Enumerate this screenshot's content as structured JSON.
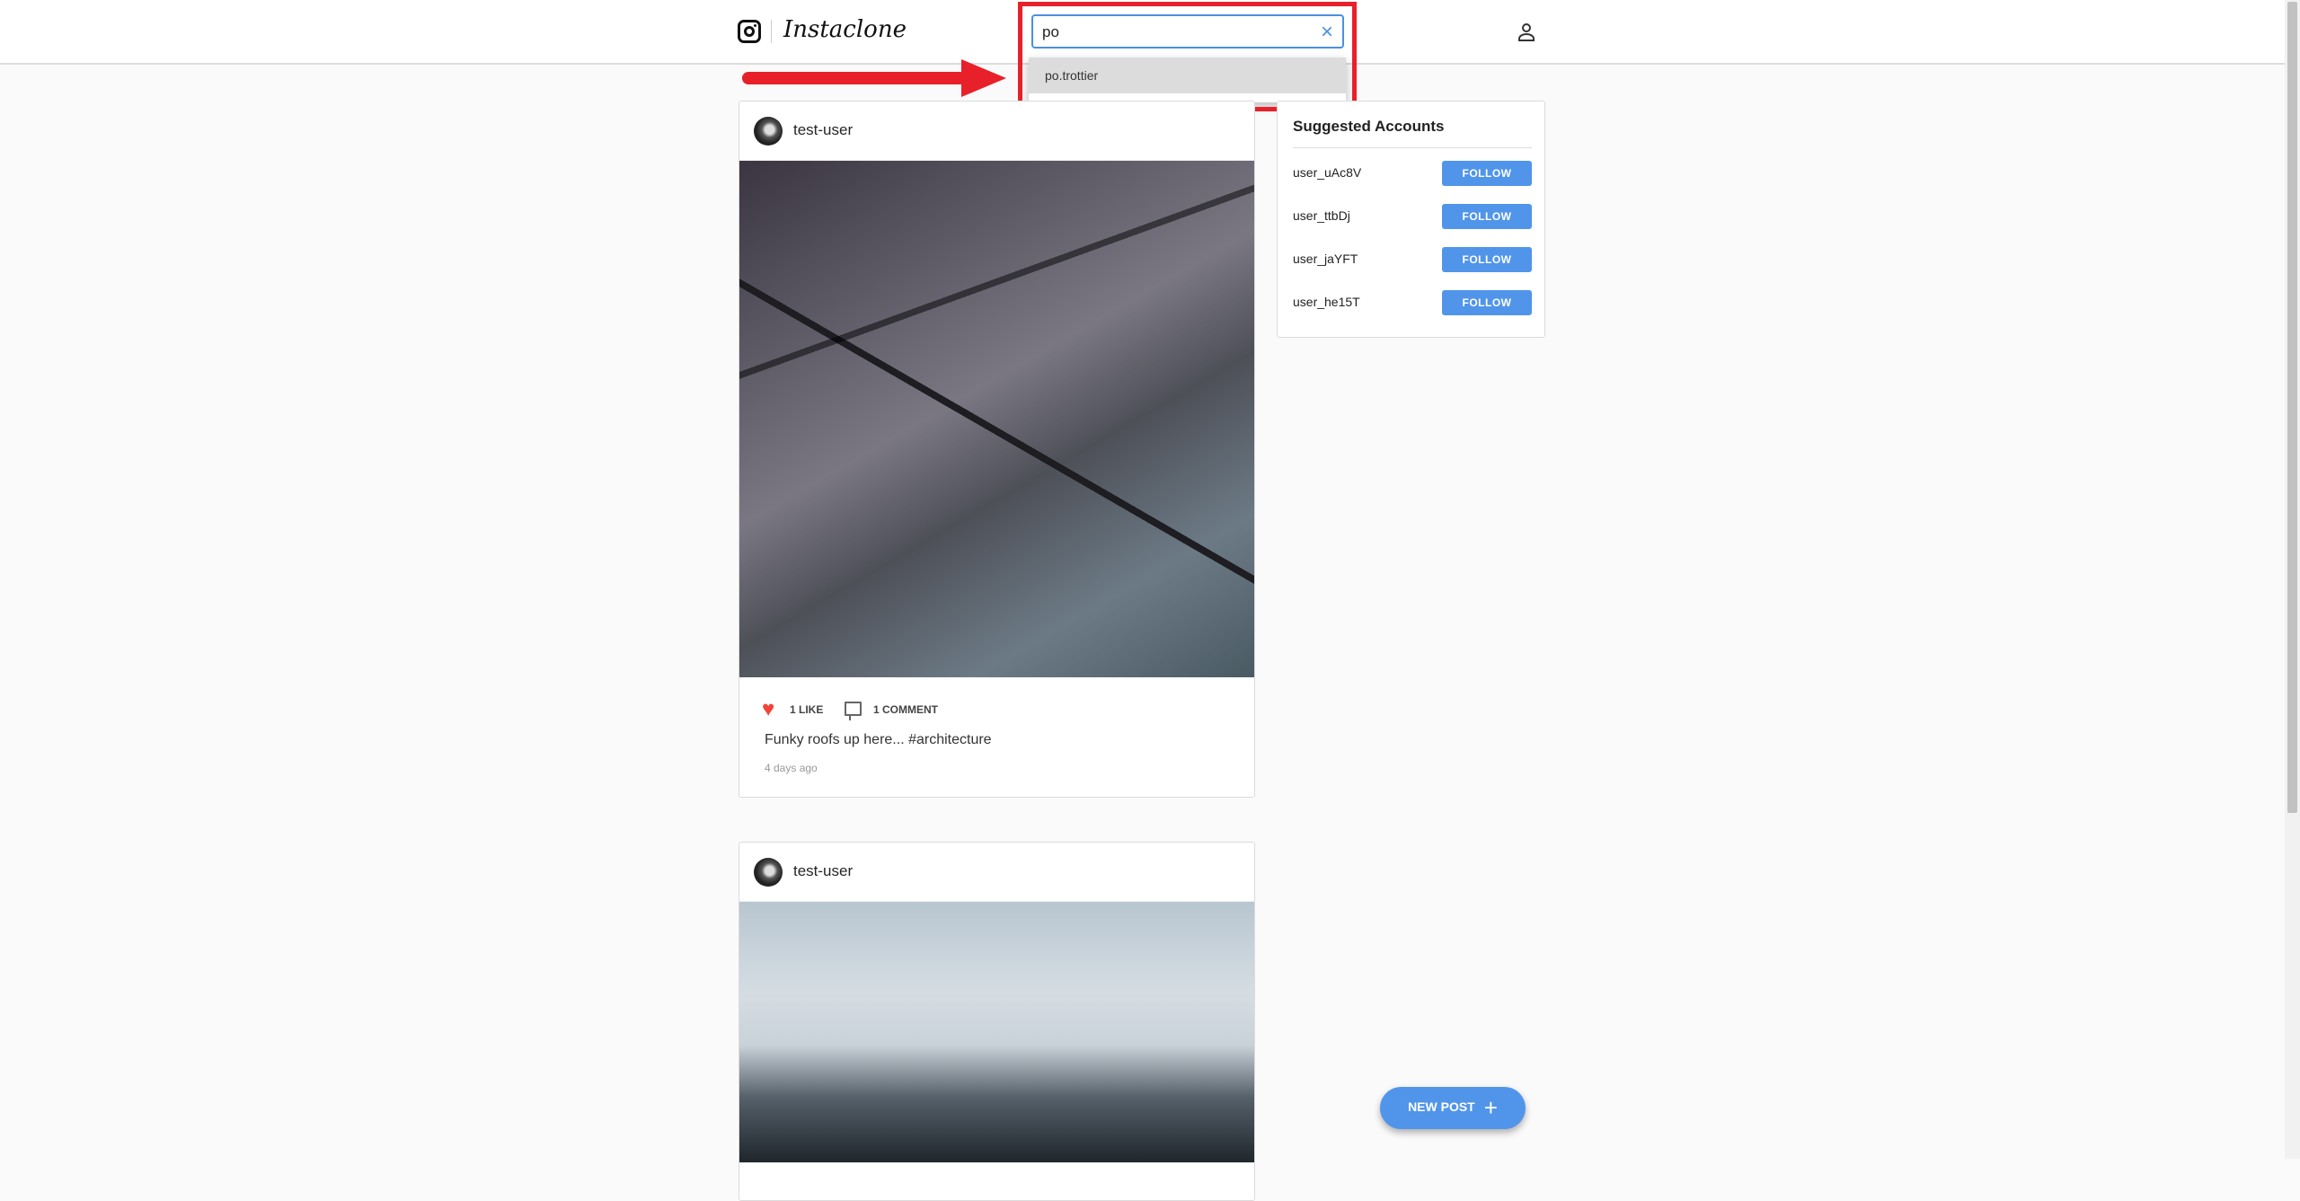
{
  "header": {
    "app_name": "Instaclone",
    "search_value": "po",
    "clear_icon": "×"
  },
  "search_results": [
    "po.trottier"
  ],
  "posts": [
    {
      "username": "test-user",
      "likes": "1 LIKE",
      "comments": "1 COMMENT",
      "caption": "Funky roofs up here... #architecture",
      "time": "4 days ago"
    },
    {
      "username": "test-user"
    }
  ],
  "suggested": {
    "title": "Suggested Accounts",
    "follow_label": "FOLLOW",
    "accounts": [
      "user_uAc8V",
      "user_ttbDj",
      "user_jaYFT",
      "user_he15T"
    ]
  },
  "fab": {
    "label": "NEW POST",
    "plus": "+"
  },
  "colors": {
    "accent": "#5195ea",
    "annotation": "#e8202a",
    "like": "#f44336"
  }
}
